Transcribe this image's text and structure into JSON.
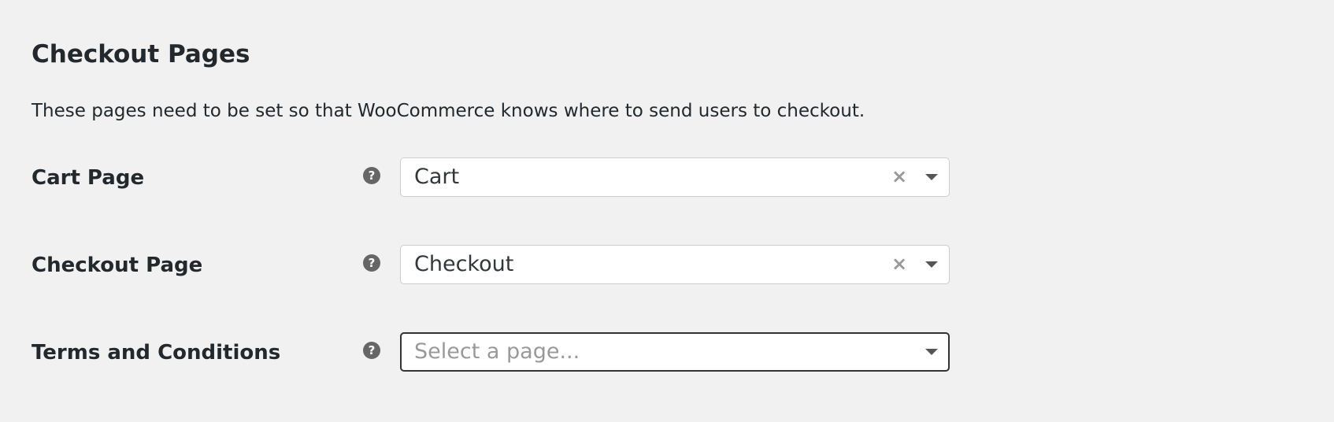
{
  "section": {
    "title": "Checkout Pages",
    "description": "These pages need to be set so that WooCommerce knows where to send users to checkout."
  },
  "help_icon_glyph": "?",
  "clear_icon_glyph": "×",
  "rows": [
    {
      "label": "Cart Page",
      "value": "Cart",
      "has_value": true
    },
    {
      "label": "Checkout Page",
      "value": "Checkout",
      "has_value": true
    },
    {
      "label": "Terms and Conditions",
      "placeholder": "Select a page...",
      "has_value": false
    }
  ],
  "colors": {
    "background": "#f1f1f1",
    "text": "#23282d",
    "help_icon": "#666666",
    "placeholder": "#999999"
  }
}
